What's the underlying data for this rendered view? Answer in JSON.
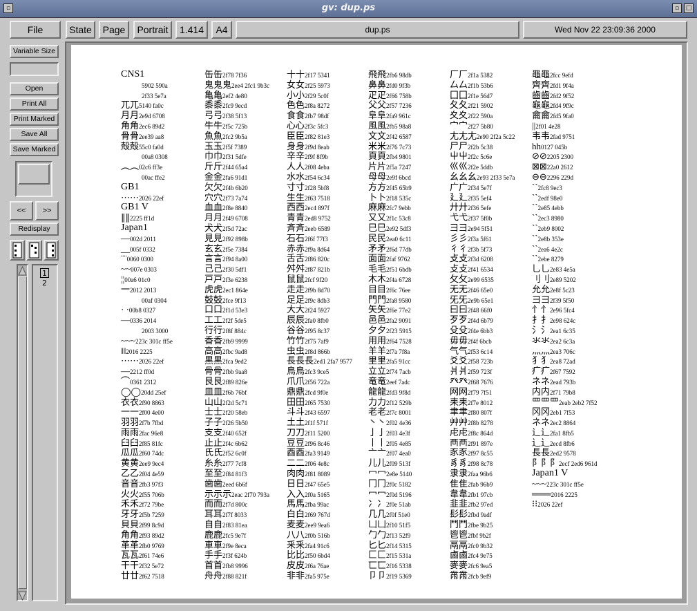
{
  "window": {
    "title": "gv: dup.ps"
  },
  "toolbar": {
    "file": "File",
    "state": "State",
    "page": "Page",
    "orientation": "Portrait",
    "scale": "1.414",
    "paper": "A4",
    "filename": "dup.ps",
    "date": "Wed Nov 22 23:09:36 2000"
  },
  "sidebar": {
    "variable_size": "Variable Size",
    "open": "Open",
    "print_all": "Print All",
    "print_marked": "Print Marked",
    "save_all": "Save All",
    "save_marked": "Save Marked",
    "prev": "<<",
    "next": ">>",
    "redisplay": "Redisplay",
    "pages": [
      "1",
      "2"
    ]
  },
  "document": {
    "columns": [
      [
        "CNS1",
        "5902 590a",
        "2f33 5e7a",
        "兀兀5140 fa0c",
        "月月2e9d 6708",
        "角角2ec6 89d2",
        "骨骨2ee39 aa8",
        "殻殻55c0 fa0d",
        "00a8 0308",
        "︵︵02c6 ff3e",
        "00ac ffe2",
        "GB1",
        "⋯⋯2026 22ef",
        "GB1 V",
        "∥∥2225 ff1d",
        "Japan1",
        "—002d 2011",
        "__005f 0332",
        "¨¨0060 0300",
        "~~007e 0303",
        "¦¦00a6 01c0",
        "一2012 2013",
        "00af 0304",
        "· ·00b8 0327",
        "—0336 2014",
        "2003 3000",
        "~~~223c 301c ff5e",
        "‖‖2016 2225",
        "⋯⋯2026 22ef",
        "—2212 ff0d",
        "⌒0361 2312",
        "◯◯20dd 25ef",
        "衣衣2f90 8863",
        "一一2f00 4e00",
        "羽羽2f7b 7fbd",
        "雨雨2fac 96e8",
        "臼臼2f85 81fc",
        "瓜瓜2f60 74dc",
        "黄黄2ee9 9ec4",
        "乙乙2f04 4e59",
        "音音2fb3 97f3",
        "火火2f55 706b",
        "禾禾2f72 79be",
        "牙牙2f5b 7259",
        "貝貝2f99 8c9d",
        "角角2f93 89d2",
        "革革2fb0 9769",
        "瓦瓦2f61 74e6",
        "干干2f32 5e72",
        "廿廿2f62 7518"
      ],
      [
        "缶缶2f78 7f36",
        "鬼鬼鬼2ee4 2fc1 9b3c",
        "亀亀2ef2 4e80",
        "黍黍2fc9 9ecd",
        "弓弓2f38 5f13",
        "牛牛2f5c 725b",
        "魚魚2fc2 9b5a",
        "玉玉2f5f 7389",
        "巾巾2f31 5dfe",
        "斤斤2f44 65a4",
        "金金2fa6 91d1",
        "欠欠2f4b 6b20",
        "穴穴2f73 7a74",
        "血血2f8e 8840",
        "月月2f49 6708",
        "犬犬2f5d 72ac",
        "見見2f92 898b",
        "玄玄2f5e 7384",
        "言言2f94 8a00",
        "己己2f30 5df1",
        "戸戸2f3e 6238",
        "虎虎2ec1 864e",
        "鼓鼓2fce 9f13",
        "口口2f1d 53e3",
        "工工2f2f 5de5",
        "行行2f8f 884c",
        "香香2fb9 9999",
        "高高2fbc 9ad8",
        "黒黒2fca 9ed2",
        "骨骨2fbb 9aa8",
        "艮艮2f89 826e",
        "皿皿2f6b 76bf",
        "山山2f2d 5c71",
        "士士2f20 58eb",
        "子子2f26 5b50",
        "支支2f40 652f",
        "止止2f4c 6b62",
        "氏氏2f52 6c0f",
        "糸糸2f77 7cf8",
        "至至2f84 81f3",
        "歯歯2eed 6b6f",
        "示示示2eac 2f70 793a",
        "而而2f7d 800c",
        "耳耳2f7f 8033",
        "自自2f83 81ea",
        "鹿鹿2fc5 9e7f",
        "車車2f9e 8eca",
        "手手2f3f 624b",
        "首首2fb8 9996",
        "舟舟2f88 821f"
      ],
      [
        "十十2f17 5341",
        "女女2f25 5973",
        "小小2f29 5c0f",
        "色色2f8a 8272",
        "食食2fb7 98df",
        "心心2f3c 5fc3",
        "臣臣2f82 81e3",
        "身身2f9d 8eab",
        "辛辛2f9f 8f9b",
        "人人2f08 4eba",
        "水水2f54 6c34",
        "寸寸2f28 5bf8",
        "生生2f63 7518",
        "西西2ec4 897f",
        "青青2ed8 9752",
        "斉斉2eeb 6589",
        "石石2f6f 77f3",
        "赤赤2f9a 8d64",
        "舌舌2f86 820c",
        "舛舛2f87 821b",
        "鼠鼠2fcf 9f20",
        "走走2f9b 8d70",
        "足足2f9c 8db3",
        "大大2f24 5927",
        "辰辰2fa0 8fb0",
        "谷谷2f95 8c37",
        "竹竹2f75 7af9",
        "虫虫2f8d 866b",
        "長長長2ed1 2fa7 9577",
        "鳥鳥2fc3 9ce5",
        "爪爪2f56 722a",
        "鼎鼎2fcd 9f0e",
        "田田2f65 7530",
        "斗斗2f43 6597",
        "土土2f1f 571f",
        "刀刀2f11 5200",
        "豆豆2f96 8c46",
        "酉酉2fa3 9149",
        "二二2f06 4e8c",
        "肉肉2f81 8089",
        "日日2f47 65e5",
        "入入2f0a 5165",
        "馬馬2fba 99ac",
        "白白2f69 767d",
        "麦麦2ee9 9ea6",
        "八八2f0b 516b",
        "釆釆2fa4 91c6",
        "比比2f50 6bd4",
        "皮皮2f6a 76ae",
        "非非2fa5 975e"
      ],
      [
        "飛飛2fb6 98db",
        "鼻鼻2fd0 9f3b",
        "疋疋2f66 758b",
        "父父2f57 7236",
        "阜阜2fa9 961c",
        "風風2fb5 98a8",
        "文文2f42 6587",
        "米米2f76 7c73",
        "頁頁2fb4 9801",
        "片片2f5a 7247",
        "母母2e9f 6bcd",
        "方方2f45 65b9",
        "卜卜2f18 535c",
        "麻麻2fc7 9ebb",
        "又又2f1c 53c8",
        "巳巳2e92 5df3",
        "民民2ea0 6c11",
        "矛矛2f6d 77db",
        "面面2faf 9762",
        "毛毛2f51 6bdb",
        "木木2f4a 6728",
        "目目2f6c 76ee",
        "門門2fa8 9580",
        "矢矢2f6e 77e2",
        "邑邑2fa2 9091",
        "夕夕2f23 5915",
        "用用2f64 7528",
        "羊羊2f7a 7f8a",
        "里里2fa5 91cc",
        "立立2f74 7acb",
        "竜竜2eef 7adc",
        "龍龍2fd3 9f8d",
        "力力2f12 529b",
        "老老2f7c 8001",
        "丶丶2f02 4e36",
        "亅亅2f03 4e3f",
        "丨丨2f05 4e85",
        "亠亠2f07 4ea0",
        "儿儿2f09 513f",
        "冖冖2e8e 5140",
        "冂冂2f0c 5182",
        "冖冖2f0d 5196",
        "冫冫2f0e 51ab",
        "几几2f0f 51e0",
        "凵凵2f10 51f5",
        "勹勹2f13 52f9",
        "匕匕2f14 5315",
        "匚匚2f15 531a",
        "匸匸2f16 5338",
        "卩卩2f19 5369"
      ],
      [
        "厂厂2f1a 5382",
        "厶厶2f1b 53b6",
        "囗囗2f1e 56d7",
        "夂夂2f21 5902",
        "夊夊2f22 590a",
        "宀宀2f27 5b80",
        "尢尢尢2e90 2f2a 5c22",
        "尸尸2f2b 5c38",
        "屮屮2f2c 5c6e",
        "巛巛2f2e 5ddb",
        "幺幺幺2e93 2f33 5e7a",
        "广广2f34 5e7f",
        "廴廴2f35 5ef4",
        "廾廾2f36 5efe",
        "弋弋2f37 5f0b",
        "彐彐2e94 5f51",
        "彡彡2f3a 5f61",
        "彳彳2f3b 5f73",
        "攴攴2f3d 6208",
        "攴攴2f41 6534",
        "攵攵2e99 6535",
        "无无2f46 65e0",
        "旡旡2e9b 65e1",
        "曰曰2f48 66f0",
        "歹歹2f4d 6b79",
        "殳殳2f4e 6bb3",
        "毋毋2f4f 6bcb",
        "气气2f53 6c14",
        "爻爻2f58 723b",
        "爿爿2f59 723f",
        "癶癶2f68 7676",
        "网网2f79 7f51",
        "耒耒2f7e 8012",
        "聿聿2f80 807f",
        "艸艸2f8b 8278",
        "虍虍2f8c 864d",
        "襾襾2f91 897e",
        "豕豕2f97 8c55",
        "豸豸2f98 8c78",
        "隶隶2faa 96b6",
        "隹隹2fab 96b9",
        "韋韋2fb1 97cb",
        "韭韭2fb2 97ed",
        "髟髟2fbd 9adf",
        "鬥鬥2fbe 9b25",
        "鬯鬯2fbf 9b2f",
        "鬲鬲2fc0 9b32",
        "鹵鹵2fc4 9e75",
        "麥麥2fc6 9ea5",
        "黹黹2fcb 9ef9"
      ],
      [
        "黽黽2fcc 9efd",
        "齊齊2fd1 9f4a",
        "齒齒2fd2 9f52",
        "龜龜2fd4 9f9c",
        "龠龠2fd5 9fa0",
        "||2f01 4e28",
        "韦韦2fad 9751",
        "hh0127 045b",
        "⊘⊘2205 2300",
        "⊠⊠22a0 2612",
        "⊖⊖2296 229d",
        "ˋˋ2fc8 9ec3",
        "ˋˋ2edf 98e0",
        "ˋˋ2e85 4ebb",
        "ˋˋ2ec3 8980",
        "ˋˋ2eb9 8002",
        "ˋˋ2e8b 353e",
        "ˋˋ2ea6 4e2c",
        "ˋˋ2ebe 8279",
        "乚乚2e83 4e5a",
        "刂刂2e89 5202",
        "允允2e8f 5c23",
        "彐彐2f39 5f50",
        "忄忄2e96 5fc4",
        "扌扌2e98 624c",
        "氵氵2ea1 6c35",
        "氺氺2ea2 6c3a",
        "灬灬2ea3 706c",
        "犭犭2ea8 72ad",
        "疒疒2f67 7592",
        "ネネ2ead 793b",
        "内内2f71 79b8",
        "罒罒罒2eab 2eb2 7f52",
        "冈冈2eb1 7f53",
        "ネネ2ec2 8864",
        "辶辶2fa1 8fb5",
        "辶辶2ecd 8fb6",
        "長長2ed2 9578",
        "阝阝阝2ecf 2ed6 961d",
        "Japan1 V",
        "~~~223c 301c ff5e",
        "═══2016 2225",
        "⁝⁝2026 22ef"
      ]
    ]
  }
}
